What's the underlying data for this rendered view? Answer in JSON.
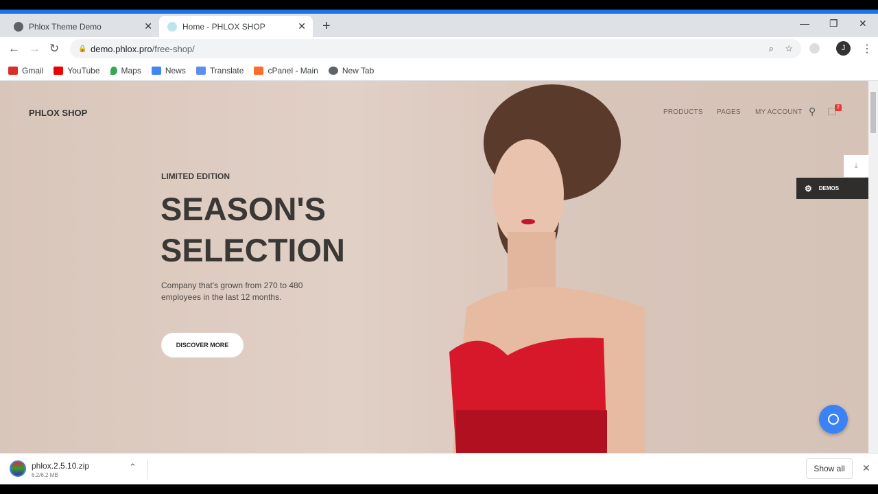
{
  "browser": {
    "tabs": [
      {
        "label": "Phlox Theme Demo",
        "active": false
      },
      {
        "label": "Home - PHLOX SHOP",
        "active": true
      }
    ],
    "url_host": "demo.phlox.pro",
    "url_path": "/free-shop/",
    "profile_initial": "J",
    "bookmarks": [
      "Gmail",
      "YouTube",
      "Maps",
      "News",
      "Translate",
      "cPanel - Main",
      "New Tab"
    ],
    "accent": "#1a73e8"
  },
  "site": {
    "logo": "PHLOX SHOP",
    "menu": [
      "PRODUCTS",
      "PAGES",
      "MY ACCOUNT"
    ],
    "cart_count": "2",
    "hero": {
      "eyebrow": "LIMITED EDITION",
      "title_line1": "SEASON'S",
      "title_line2": "SELECTION",
      "description": "Company that's grown from 270 to 480 employees in the last 12 months.",
      "cta": "DISCOVER MORE"
    },
    "demos_label": "DEMOS"
  },
  "downloads": {
    "file_name": "phlox.2.5.10.zip",
    "file_size": "6.2/6.2 MB",
    "show_all": "Show all"
  }
}
